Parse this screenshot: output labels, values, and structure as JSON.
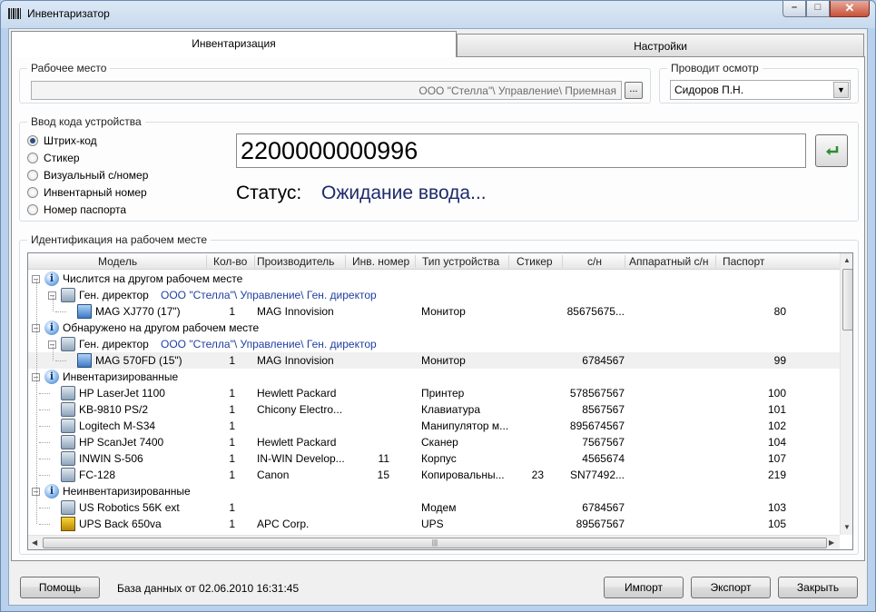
{
  "window": {
    "title": "Инвентаризатор",
    "minimize": "–",
    "maximize": "□",
    "close": "✕"
  },
  "tabs": [
    {
      "label": "Инвентаризация"
    },
    {
      "label": "Настройки"
    }
  ],
  "workplace": {
    "group_title": "Рабочее место",
    "value": "ООО \"Стелла\"\\ Управление\\ Приемная",
    "browse_label": "..."
  },
  "inspector": {
    "group_title": "Проводит осмотр",
    "value": "Сидоров П.Н."
  },
  "code_entry": {
    "group_title": "Ввод кода устройства",
    "options": [
      "Штрих-код",
      "Стикер",
      "Визуальный с/номер",
      "Инвентарный номер",
      "Номер паспорта"
    ],
    "selected": "Штрих-код",
    "code_value": "2200000000996",
    "status_label": "Статус:",
    "status_value": "Ожидание ввода..."
  },
  "identification": {
    "group_title": "Идентификация на рабочем месте",
    "columns": [
      "Модель",
      "Кол-во",
      "Производитель",
      "Инв. номер",
      "Тип устройства",
      "Стикер",
      "с/н",
      "Аппаратный с/н",
      "Паспорт"
    ],
    "rows": [
      {
        "level": 0,
        "icon": "info-icon",
        "model": "Числится на другом рабочем месте"
      },
      {
        "level": 1,
        "icon": "workstation-icon",
        "model": "Ген. директор",
        "location": "ООО \"Стелла\"\\ Управление\\ Ген. директор"
      },
      {
        "level": 2,
        "icon": "monitor-icon",
        "model": "MAG XJ770 (17\")",
        "qty": "1",
        "vendor": "MAG Innovision",
        "inv": "",
        "type": "Монитор",
        "sticker": "",
        "sn": "85675675...",
        "hw_sn": "",
        "passport": "80"
      },
      {
        "level": 0,
        "icon": "info-icon",
        "model": "Обнаружено на другом рабочем месте"
      },
      {
        "level": 1,
        "icon": "workstation-icon",
        "model": "Ген. директор",
        "location": "ООО \"Стелла\"\\ Управление\\ Ген. директор"
      },
      {
        "level": 2,
        "icon": "monitor-icon",
        "model": "MAG 570FD (15\")",
        "qty": "1",
        "vendor": "MAG Innovision",
        "inv": "",
        "type": "Монитор",
        "sticker": "",
        "sn": "6784567",
        "hw_sn": "",
        "passport": "99",
        "selected": true
      },
      {
        "level": 0,
        "icon": "info-icon",
        "model": "Инвентаризированные"
      },
      {
        "level": 1,
        "icon": "printer-icon",
        "model": "HP LaserJet 1100",
        "qty": "1",
        "vendor": "Hewlett Packard",
        "inv": "",
        "type": "Принтер",
        "sticker": "",
        "sn": "578567567",
        "hw_sn": "",
        "passport": "100"
      },
      {
        "level": 1,
        "icon": "keyboard-icon",
        "model": "KB-9810 PS/2",
        "qty": "1",
        "vendor": "Chicony Electro...",
        "inv": "",
        "type": "Клавиатура",
        "sticker": "",
        "sn": "8567567",
        "hw_sn": "",
        "passport": "101"
      },
      {
        "level": 1,
        "icon": "mouse-icon",
        "model": "Logitech M-S34",
        "qty": "1",
        "vendor": "",
        "inv": "",
        "type": "Манипулятор м...",
        "sticker": "",
        "sn": "895674567",
        "hw_sn": "",
        "passport": "102"
      },
      {
        "level": 1,
        "icon": "scanner-icon",
        "model": "HP ScanJet 7400",
        "qty": "1",
        "vendor": "Hewlett Packard",
        "inv": "",
        "type": "Сканер",
        "sticker": "",
        "sn": "7567567",
        "hw_sn": "",
        "passport": "104"
      },
      {
        "level": 1,
        "icon": "case-icon",
        "model": "INWIN S-506",
        "qty": "1",
        "vendor": "IN-WIN Develop...",
        "inv": "11",
        "type": "Корпус",
        "sticker": "",
        "sn": "4565674",
        "hw_sn": "",
        "passport": "107"
      },
      {
        "level": 1,
        "icon": "copier-icon",
        "model": "FC-128",
        "qty": "1",
        "vendor": "Canon",
        "inv": "15",
        "type": "Копировальны...",
        "sticker": "23",
        "sn": "SN77492...",
        "hw_sn": "",
        "passport": "219"
      },
      {
        "level": 0,
        "icon": "info-icon",
        "model": "Неинвентаризированные"
      },
      {
        "level": 1,
        "icon": "modem-icon",
        "model": "US Robotics 56K ext",
        "qty": "1",
        "vendor": "",
        "inv": "",
        "type": "Модем",
        "sticker": "",
        "sn": "6784567",
        "hw_sn": "",
        "passport": "103"
      },
      {
        "level": 1,
        "icon": "ups-icon",
        "model": "UPS Back 650va",
        "qty": "1",
        "vendor": "APC Corp.",
        "inv": "",
        "type": "UPS",
        "sticker": "",
        "sn": "89567567",
        "hw_sn": "",
        "passport": "105"
      }
    ]
  },
  "footer": {
    "help": "Помощь",
    "db_info": "База данных от 02.06.2010 16:31:45",
    "import": "Импорт",
    "export": "Экспорт",
    "close": "Закрыть"
  }
}
